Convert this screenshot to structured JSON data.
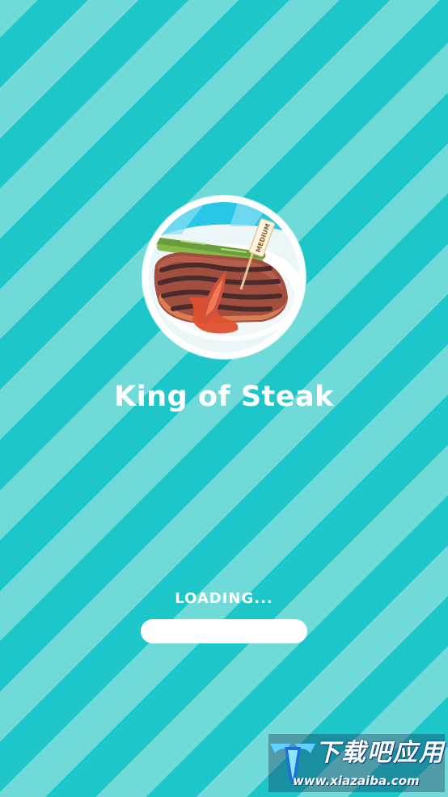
{
  "game": {
    "title": "King of Steak",
    "logo_tag": "MEDIUM"
  },
  "loading": {
    "label": "LOADING...",
    "progress": 0
  },
  "watermark": {
    "title": "下载吧应用",
    "url": "www.xiazaiba.com"
  },
  "colors": {
    "stripe_light": "#6fdad7",
    "stripe_dark": "#1cc6c9",
    "text": "#ffffff",
    "progress_track": "#ffffff"
  },
  "icons": {
    "logo": "steak-plate-icon",
    "watermark": "download-site-logo-icon"
  }
}
